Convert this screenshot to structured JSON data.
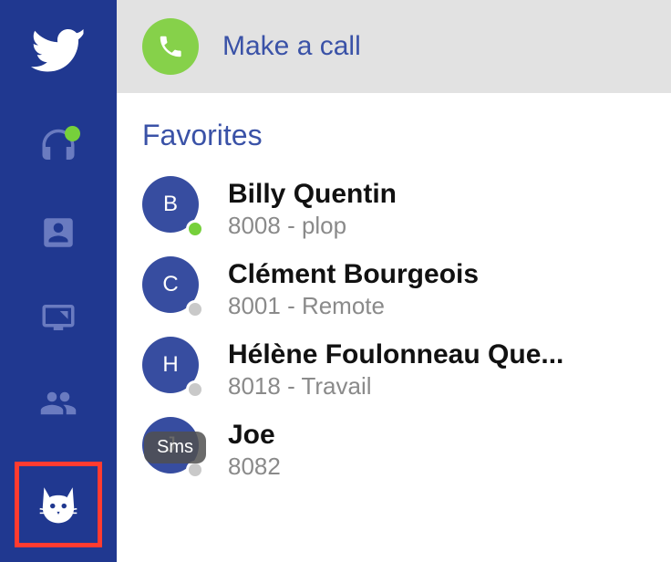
{
  "call_bar": {
    "label": "Make a call"
  },
  "section_title": "Favorites",
  "sidebar": {
    "items": [
      {
        "name": "headset",
        "presence": true
      },
      {
        "name": "contacts"
      },
      {
        "name": "screen-share"
      },
      {
        "name": "group"
      }
    ]
  },
  "contacts": [
    {
      "initial": "B",
      "name": "Billy Quentin",
      "sub": "8008 - plop",
      "status": "online"
    },
    {
      "initial": "C",
      "name": "Clément Bourgeois",
      "sub": "8001 - Remote",
      "status": "offline"
    },
    {
      "initial": "H",
      "name": "Hélène Foulonneau Que...",
      "sub": "8018 - Travail",
      "status": "offline"
    },
    {
      "initial": "J",
      "name": "Joe",
      "sub": "8082",
      "status": "offline",
      "badge": "Sms"
    }
  ]
}
